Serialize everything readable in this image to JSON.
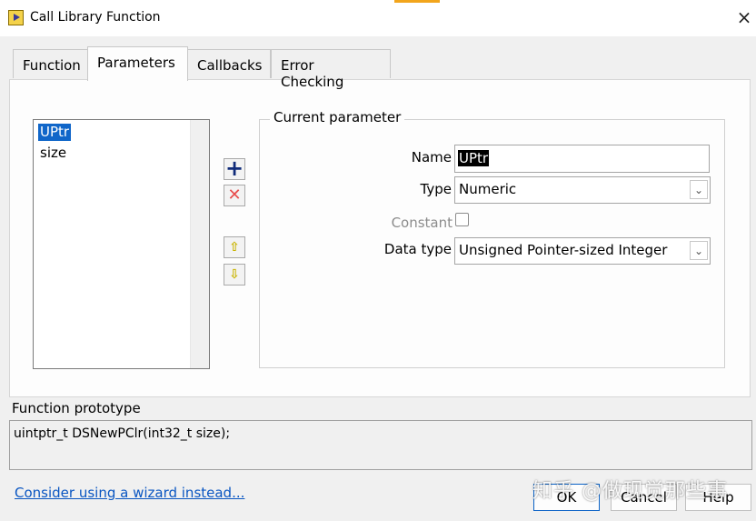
{
  "window": {
    "title": "Call Library Function",
    "close_glyph": "×",
    "app_icon": "labview-icon"
  },
  "tabs": [
    {
      "label": "Function",
      "active": false
    },
    {
      "label": "Parameters",
      "active": true
    },
    {
      "label": "Callbacks",
      "active": false
    },
    {
      "label": "Error Checking",
      "active": false
    }
  ],
  "params_list": {
    "items": [
      "UPtr",
      "size"
    ],
    "selected_index": 0
  },
  "param_buttons": {
    "add": "add-icon",
    "remove": "remove-icon",
    "up": "arrow-up-icon",
    "down": "arrow-down-icon"
  },
  "current_parameter": {
    "legend": "Current parameter",
    "name_label": "Name",
    "name_value": "UPtr",
    "type_label": "Type",
    "type_value": "Numeric",
    "constant_label": "Constant",
    "constant_checked": false,
    "data_type_label": "Data type",
    "data_type_value": "Unsigned Pointer-sized Integer"
  },
  "prototype": {
    "label": "Function prototype",
    "text": "uintptr_t DSNewPClr(int32_t size);"
  },
  "footer": {
    "wizard_link": "Consider using a wizard instead...",
    "ok": "OK",
    "cancel": "Cancel",
    "help": "Help",
    "watermark": "知乎 @做现觉那些事"
  },
  "colors": {
    "accent": "#1066c9",
    "link": "#0a56c2"
  }
}
